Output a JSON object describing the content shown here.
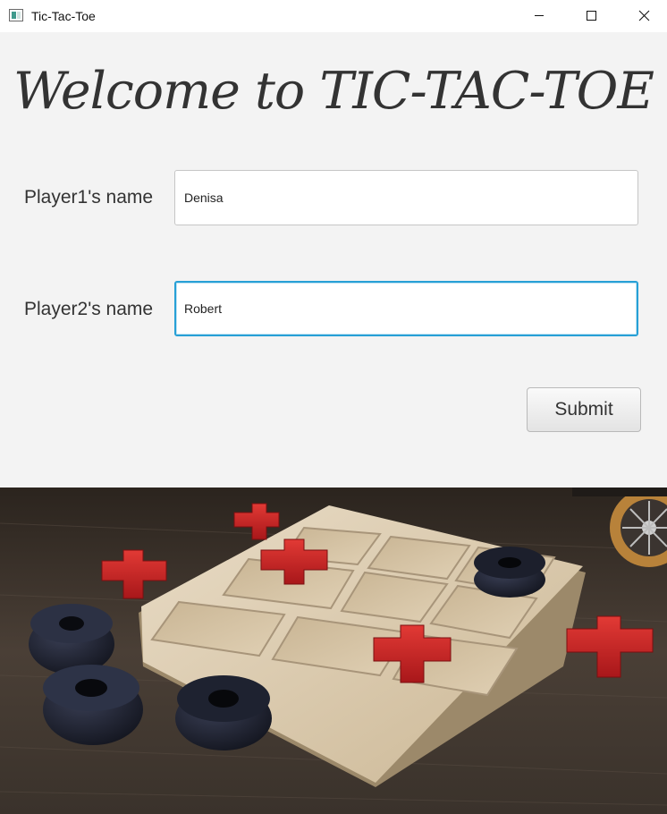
{
  "window": {
    "title": "Tic-Tac-Toe",
    "icon": "app-window-icon",
    "controls": [
      "minimize-icon",
      "maximize-icon",
      "close-icon"
    ]
  },
  "heading": {
    "text": "Welcome to TIC-TAC-TOE"
  },
  "form": {
    "player1": {
      "label": "Player1's name",
      "value": "Denisa"
    },
    "player2": {
      "label": "Player2's name",
      "value": "Robert"
    },
    "submit_label": "Submit"
  },
  "colors": {
    "window_background": "#f3f3f3",
    "focus_ring": "#27a0d6",
    "text": "#333333"
  },
  "image": {
    "subject": "tic-tac-toe-board-photo"
  }
}
